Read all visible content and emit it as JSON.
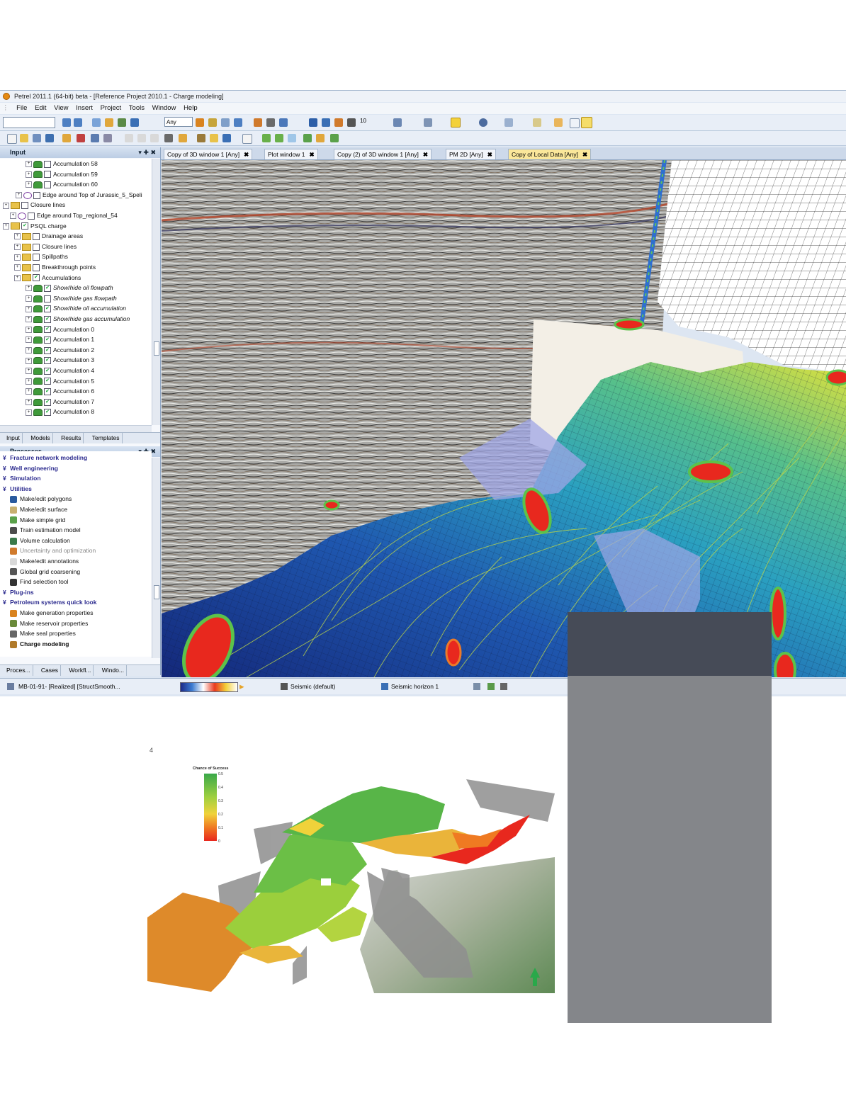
{
  "window": {
    "title": "Petrel 2011.1 (64-bit) beta - [Reference Project 2010.1 - Charge modeling]"
  },
  "menu": [
    "File",
    "Edit",
    "View",
    "Insert",
    "Project",
    "Tools",
    "Window",
    "Help"
  ],
  "toolbar": {
    "filter_value": "Any",
    "number_value": "10"
  },
  "input_panel": {
    "title": "Input",
    "tree": [
      {
        "label": "Accumulation 58",
        "checked": false
      },
      {
        "label": "Accumulation 59",
        "checked": false
      },
      {
        "label": "Accumulation 60",
        "checked": false
      },
      {
        "label": "Edge around Top of Jurassic_5_Speli",
        "checked": false
      },
      {
        "label": "Closure lines",
        "checked": false
      },
      {
        "label": "Edge around Top_regional_54",
        "checked": false
      },
      {
        "label": "PSQL charge",
        "checked": true
      },
      {
        "label": "Drainage areas",
        "checked": false
      },
      {
        "label": "Closure lines",
        "checked": false
      },
      {
        "label": "Spillpaths",
        "checked": false
      },
      {
        "label": "Breakthrough points",
        "checked": false
      },
      {
        "label": "Accumulations",
        "checked": true
      },
      {
        "label": "Show/hide oil flowpath",
        "checked": true
      },
      {
        "label": "Show/hide gas flowpath",
        "checked": false
      },
      {
        "label": "Show/hide oil accumulation",
        "checked": true
      },
      {
        "label": "Show/hide gas accumulation",
        "checked": true
      },
      {
        "label": "Accumulation 0",
        "checked": true
      },
      {
        "label": "Accumulation 1",
        "checked": true
      },
      {
        "label": "Accumulation 2",
        "checked": true
      },
      {
        "label": "Accumulation 3",
        "checked": true
      },
      {
        "label": "Accumulation 4",
        "checked": true
      },
      {
        "label": "Accumulation 5",
        "checked": true
      },
      {
        "label": "Accumulation 6",
        "checked": true
      },
      {
        "label": "Accumulation 7",
        "checked": true
      },
      {
        "label": "Accumulation 8",
        "checked": true
      }
    ],
    "tabs": [
      "Input",
      "Models",
      "Results",
      "Templates"
    ]
  },
  "processes_panel": {
    "title": "Processes",
    "items": [
      {
        "label": "Fracture network modeling",
        "category": true
      },
      {
        "label": "Well engineering",
        "category": true
      },
      {
        "label": "Simulation",
        "category": true
      },
      {
        "label": "Utilities",
        "category": true
      },
      {
        "label": "Make/edit polygons",
        "category": false
      },
      {
        "label": "Make/edit surface",
        "category": false
      },
      {
        "label": "Make simple grid",
        "category": false
      },
      {
        "label": "Train estimation model",
        "category": false
      },
      {
        "label": "Volume calculation",
        "category": false
      },
      {
        "label": "Uncertainty and optimization",
        "category": false
      },
      {
        "label": "Make/edit annotations",
        "category": false
      },
      {
        "label": "Global grid coarsening",
        "category": false
      },
      {
        "label": "Find selection tool",
        "category": false
      },
      {
        "label": "Plug-ins",
        "category": true
      },
      {
        "label": "Petroleum systems quick look",
        "category": true
      },
      {
        "label": "Make generation properties",
        "category": false
      },
      {
        "label": "Make reservoir properties",
        "category": false
      },
      {
        "label": "Make seal properties",
        "category": false
      },
      {
        "label": "Charge modeling",
        "category": false
      }
    ],
    "tabs": [
      "Proces...",
      "Cases",
      "Workfl...",
      "Windo..."
    ]
  },
  "view_tabs": [
    {
      "label": "Copy of 3D window 1 [Any]",
      "active": false
    },
    {
      "label": "Plot window 1",
      "active": false
    },
    {
      "label": "Copy (2) of 3D window 1 [Any]",
      "active": false
    },
    {
      "label": "PM 2D [Any]",
      "active": false
    },
    {
      "label": "Copy of Local Data [Any]",
      "active": true
    }
  ],
  "status": {
    "object": "MB-01-91- [Realized] [StructSmooth...",
    "seismic": "Seismic (default)",
    "horizon": "Seismic horizon 1"
  },
  "figure": {
    "page_mark": "4",
    "legend_title": "Chance of Success",
    "legend_ticks": [
      "0.5",
      "0.4",
      "0.3",
      "0.2",
      "0.1",
      "0"
    ]
  },
  "colors": {
    "oil_accumulation": "#e8281e",
    "surface_deep": "#1c3a8e",
    "surface_high": "#e6e040",
    "flowpath": "#b9d24a",
    "panel_blue": "#dde6f2",
    "active_tab": "#fbe79a"
  }
}
